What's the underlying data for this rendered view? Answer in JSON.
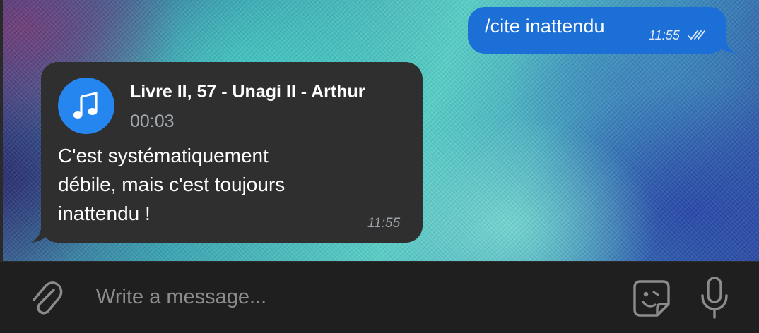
{
  "messages": {
    "outgoing": {
      "text": "/cite inattendu",
      "time": "11:55",
      "status_icon": "double-check-icon",
      "color": "#1c6fd6"
    },
    "incoming": {
      "audio": {
        "title": "Livre II, 57 - Unagi II - Arthur",
        "duration": "00:03",
        "icon": "music-note-icon",
        "color": "#2686f0"
      },
      "text": "C'est systématiquement\ndébile, mais c'est toujours\ninattendu !",
      "time": "11:55",
      "color": "#2f2f2f"
    }
  },
  "composer": {
    "placeholder": "Write a message...",
    "value": "",
    "icons": [
      "paperclip-icon",
      "sticker-icon",
      "microphone-icon"
    ]
  }
}
